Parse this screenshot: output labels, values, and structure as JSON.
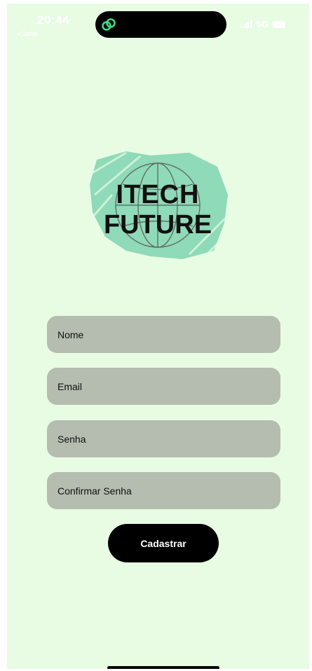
{
  "status_bar": {
    "time": "20:44",
    "back_label": "◂ Safari",
    "network": "5G",
    "signal_icon": "signal-bars-icon",
    "battery_icon": "battery-icon"
  },
  "dynamic_island": {
    "icon": "linked-rings-icon",
    "icon_color": "#3ddc84"
  },
  "logo": {
    "line1": "ITECH",
    "line2": "FUTURE",
    "brush_color": "#7fd3b0"
  },
  "form": {
    "name_placeholder": "Nome",
    "email_placeholder": "Email",
    "password_placeholder": "Senha",
    "confirm_password_placeholder": "Confirmar Senha",
    "submit_label": "Cadastrar"
  },
  "colors": {
    "background": "#e8fbe3",
    "field": "#b4bdb0",
    "button": "#000000"
  }
}
